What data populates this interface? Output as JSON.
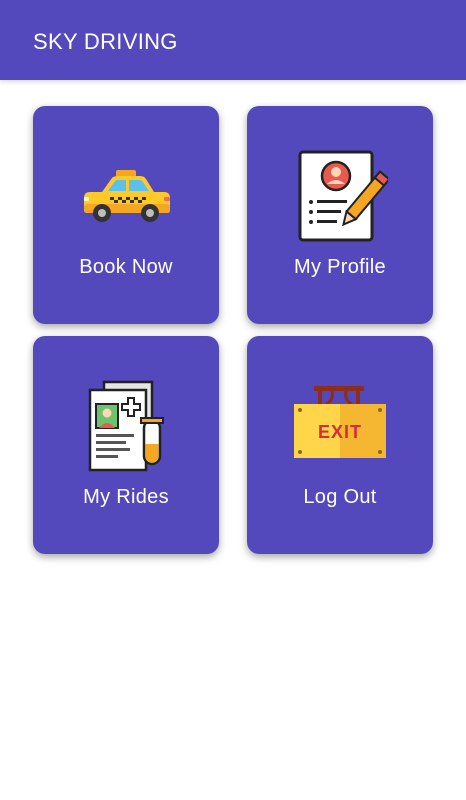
{
  "app_bar": {
    "title": "SKY DRIVING"
  },
  "menu": {
    "items": [
      {
        "label": "Book Now",
        "icon": "taxi-car-icon"
      },
      {
        "label": "My Profile",
        "icon": "profile-form-icon"
      },
      {
        "label": "My Rides",
        "icon": "ride-record-icon"
      },
      {
        "label": "Log Out",
        "icon": "exit-sign-icon",
        "sign_text": "EXIT"
      }
    ]
  },
  "colors": {
    "primary": "#5349BD",
    "background": "#FFFFFF",
    "text_on_primary": "#FFFFFF"
  }
}
